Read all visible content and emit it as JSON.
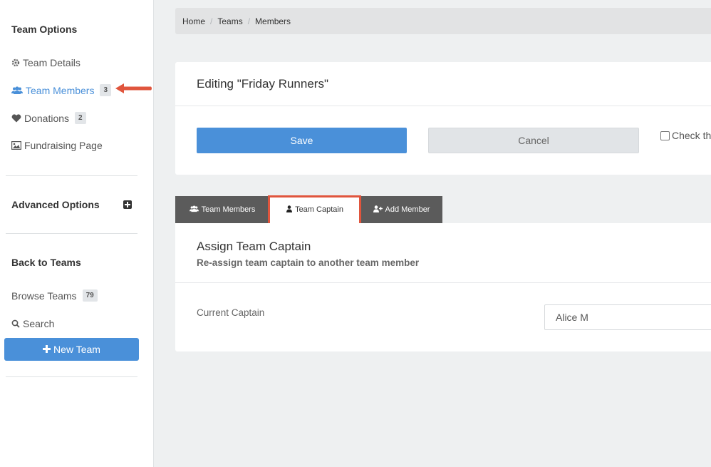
{
  "sidebar": {
    "team_options_title": "Team Options",
    "items": [
      {
        "label": "Team Details",
        "icon": "gear-icon"
      },
      {
        "label": "Team Members",
        "badge": "3",
        "icon": "users-icon",
        "active": true
      },
      {
        "label": "Donations",
        "badge": "2",
        "icon": "heart-icon"
      },
      {
        "label": "Fundraising Page",
        "icon": "image-icon"
      }
    ],
    "advanced_title": "Advanced Options",
    "back_title": "Back to Teams",
    "browse_label": "Browse Teams",
    "browse_badge": "79",
    "search_label": "Search",
    "new_team_label": "New Team"
  },
  "breadcrumb": [
    "Home",
    "Teams",
    "Members"
  ],
  "editor": {
    "title": "Editing \"Friday Runners\"",
    "save_label": "Save",
    "cancel_label": "Cancel",
    "checkbox_label": "Check th"
  },
  "tabs": [
    {
      "label": "Team Members",
      "icon": "users-icon"
    },
    {
      "label": "Team Captain",
      "icon": "user-icon",
      "active": true
    },
    {
      "label": "Add Member",
      "icon": "user-plus-icon"
    }
  ],
  "captain": {
    "title": "Assign Team Captain",
    "subtitle": "Re-assign team captain to another team member",
    "current_label": "Current Captain",
    "current_value": "Alice M"
  },
  "colors": {
    "accent": "#4a90d9",
    "annotation": "#e0553d",
    "tab_bar": "#5b5b5b"
  }
}
